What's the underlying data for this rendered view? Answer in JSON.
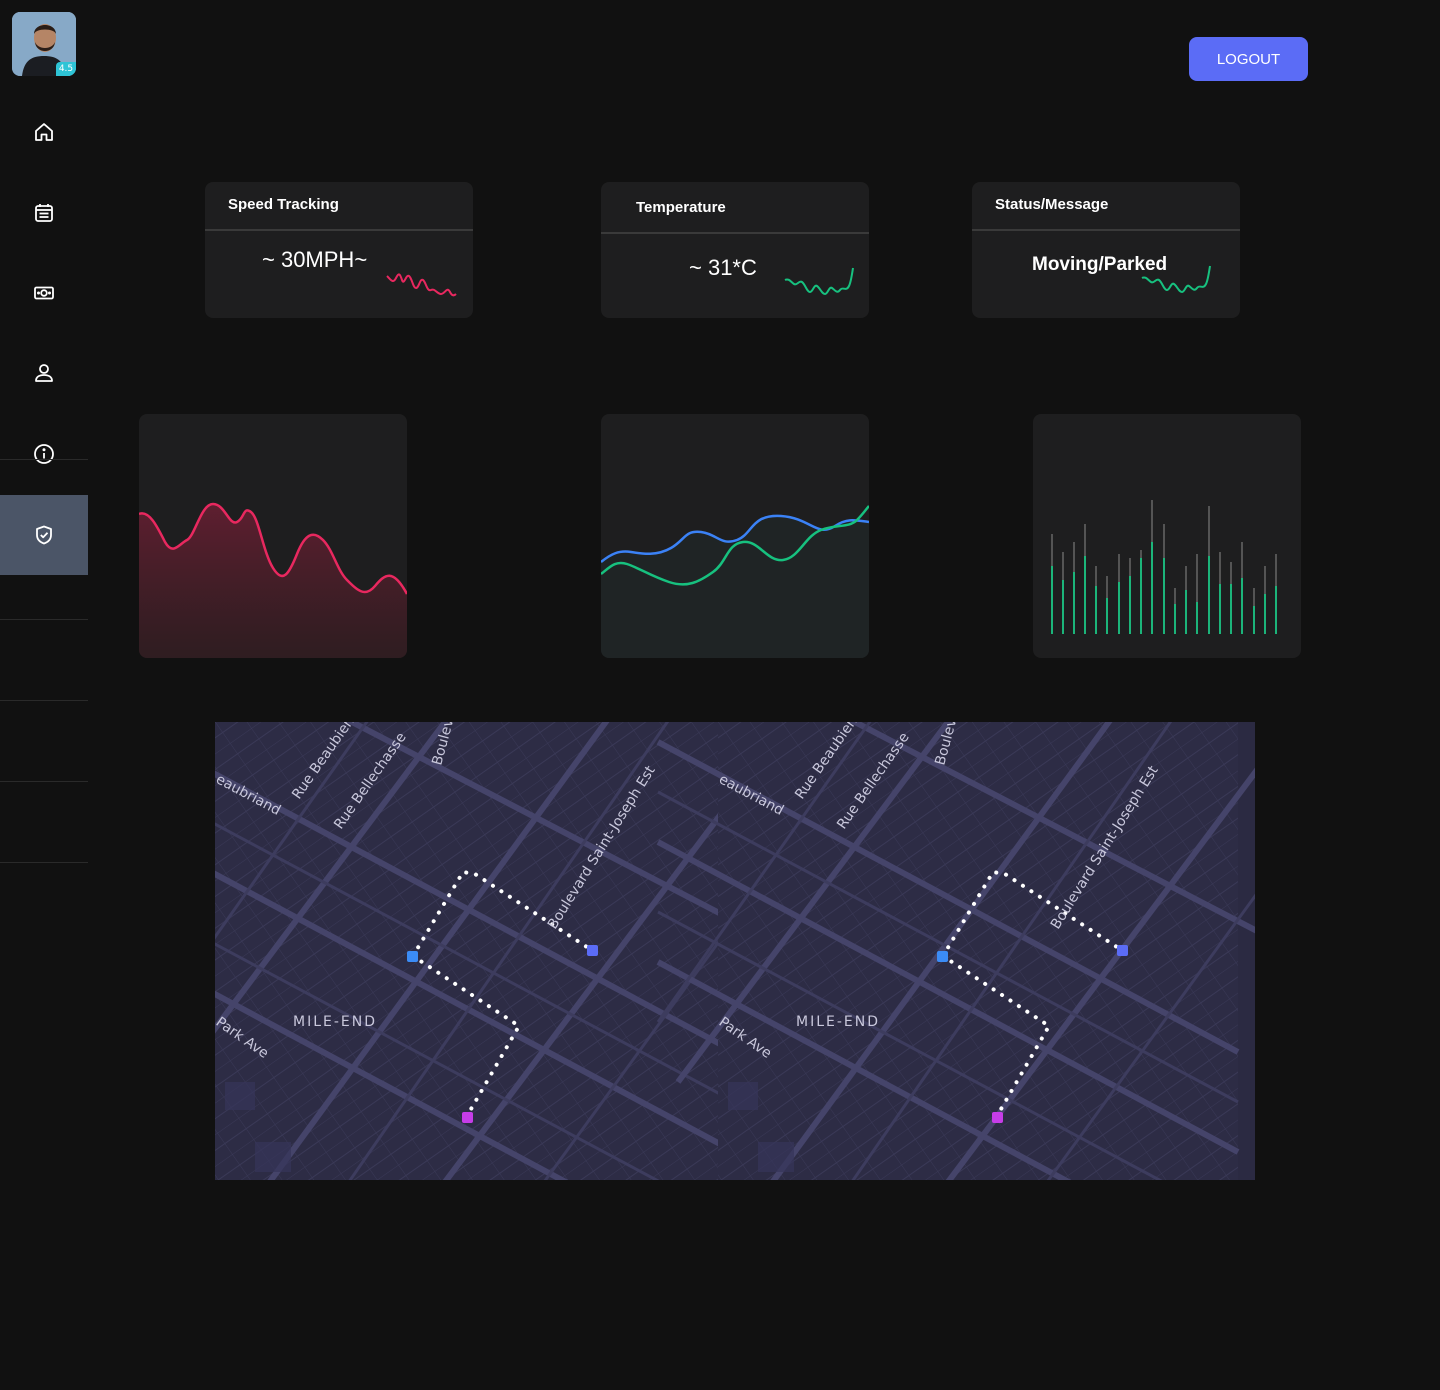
{
  "sidebar": {
    "avatar_badge": "4.5",
    "items": [
      {
        "name": "home-icon"
      },
      {
        "name": "calendar-icon"
      },
      {
        "name": "money-icon"
      },
      {
        "name": "user-icon"
      },
      {
        "name": "info-icon"
      },
      {
        "name": "shield-check-icon",
        "active": true
      }
    ]
  },
  "header": {
    "logout_label": "LOGOUT"
  },
  "cards": {
    "speed": {
      "title": "Speed Tracking",
      "value": "~ 30MPH~"
    },
    "temperature": {
      "title": "Temperature",
      "value": "~ 31*C"
    },
    "status": {
      "title": "Status/Message",
      "value": "Moving/Parked"
    }
  },
  "colors": {
    "accent": "#5b6cf6",
    "pink": "#e8285f",
    "green": "#17c17f",
    "blue": "#3b82f6",
    "sidebar_active": "#4b5567"
  },
  "map": {
    "labels": [
      "eaubriand",
      "Rue Beaubien",
      "Rue Bellechasse",
      "Boulev",
      "Boulevard Saint-Joseph Est",
      "MILE-END",
      "Park Ave"
    ]
  }
}
